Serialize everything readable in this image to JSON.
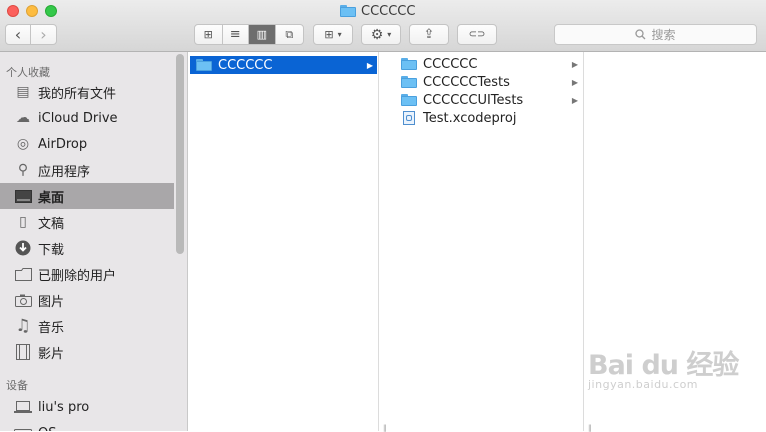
{
  "window": {
    "title": "CCCCCC"
  },
  "toolbar": {
    "nav_back": "‹",
    "nav_forward": "›",
    "view_icons": "⊞",
    "view_list": "≡",
    "view_columns": "▥",
    "view_coverflow": "⧉",
    "arrange_label": "⊞",
    "action_label": "⚙",
    "dropdown_chevron": "▾",
    "share_label": "⇪",
    "tag_label": "⊂⊃",
    "search_placeholder": "搜索"
  },
  "sidebar": {
    "favorites_header": "个人收藏",
    "favorites": [
      {
        "label": "我的所有文件",
        "icon": "all-files-icon",
        "glyph": "▤"
      },
      {
        "label": "iCloud Drive",
        "icon": "cloud-icon",
        "glyph": "☁"
      },
      {
        "label": "AirDrop",
        "icon": "airdrop-icon",
        "glyph": "◎"
      },
      {
        "label": "应用程序",
        "icon": "applications-icon",
        "glyph": "⚲"
      },
      {
        "label": "桌面",
        "icon": "desktop-icon",
        "glyph": "▭"
      },
      {
        "label": "文稿",
        "icon": "documents-icon",
        "glyph": "▯"
      },
      {
        "label": "下载",
        "icon": "downloads-icon",
        "glyph": "⬇"
      },
      {
        "label": "已删除的用户",
        "icon": "folder-icon",
        "glyph": "▭"
      },
      {
        "label": "图片",
        "icon": "pictures-icon",
        "glyph": "◙"
      },
      {
        "label": "音乐",
        "icon": "music-icon",
        "glyph": "♫"
      },
      {
        "label": "影片",
        "icon": "movies-icon",
        "glyph": "▦"
      }
    ],
    "devices_header": "设备",
    "devices": [
      {
        "label": "liu's pro",
        "icon": "laptop-icon",
        "glyph": "▭"
      },
      {
        "label": "OS",
        "icon": "disk-icon",
        "glyph": "▭"
      }
    ],
    "selected_index": 4
  },
  "columns": {
    "col1": [
      {
        "name": "CCCCCC",
        "type": "folder",
        "has_children": true,
        "selected": true
      }
    ],
    "col2": [
      {
        "name": "CCCCCC",
        "type": "folder",
        "has_children": true
      },
      {
        "name": "CCCCCCTests",
        "type": "folder",
        "has_children": true
      },
      {
        "name": "CCCCCCUITests",
        "type": "folder",
        "has_children": true
      },
      {
        "name": "Test.xcodeproj",
        "type": "file",
        "has_children": false
      }
    ],
    "arrow_glyph": "▶",
    "resize_glyph": "||"
  },
  "watermark": {
    "brand": "Bai du 经验",
    "url": "jingyan.baidu.com"
  },
  "colors": {
    "selection": "#0a64d4",
    "sidebar_selected": "#a9a7a9",
    "folder": "#6cc0f4"
  }
}
